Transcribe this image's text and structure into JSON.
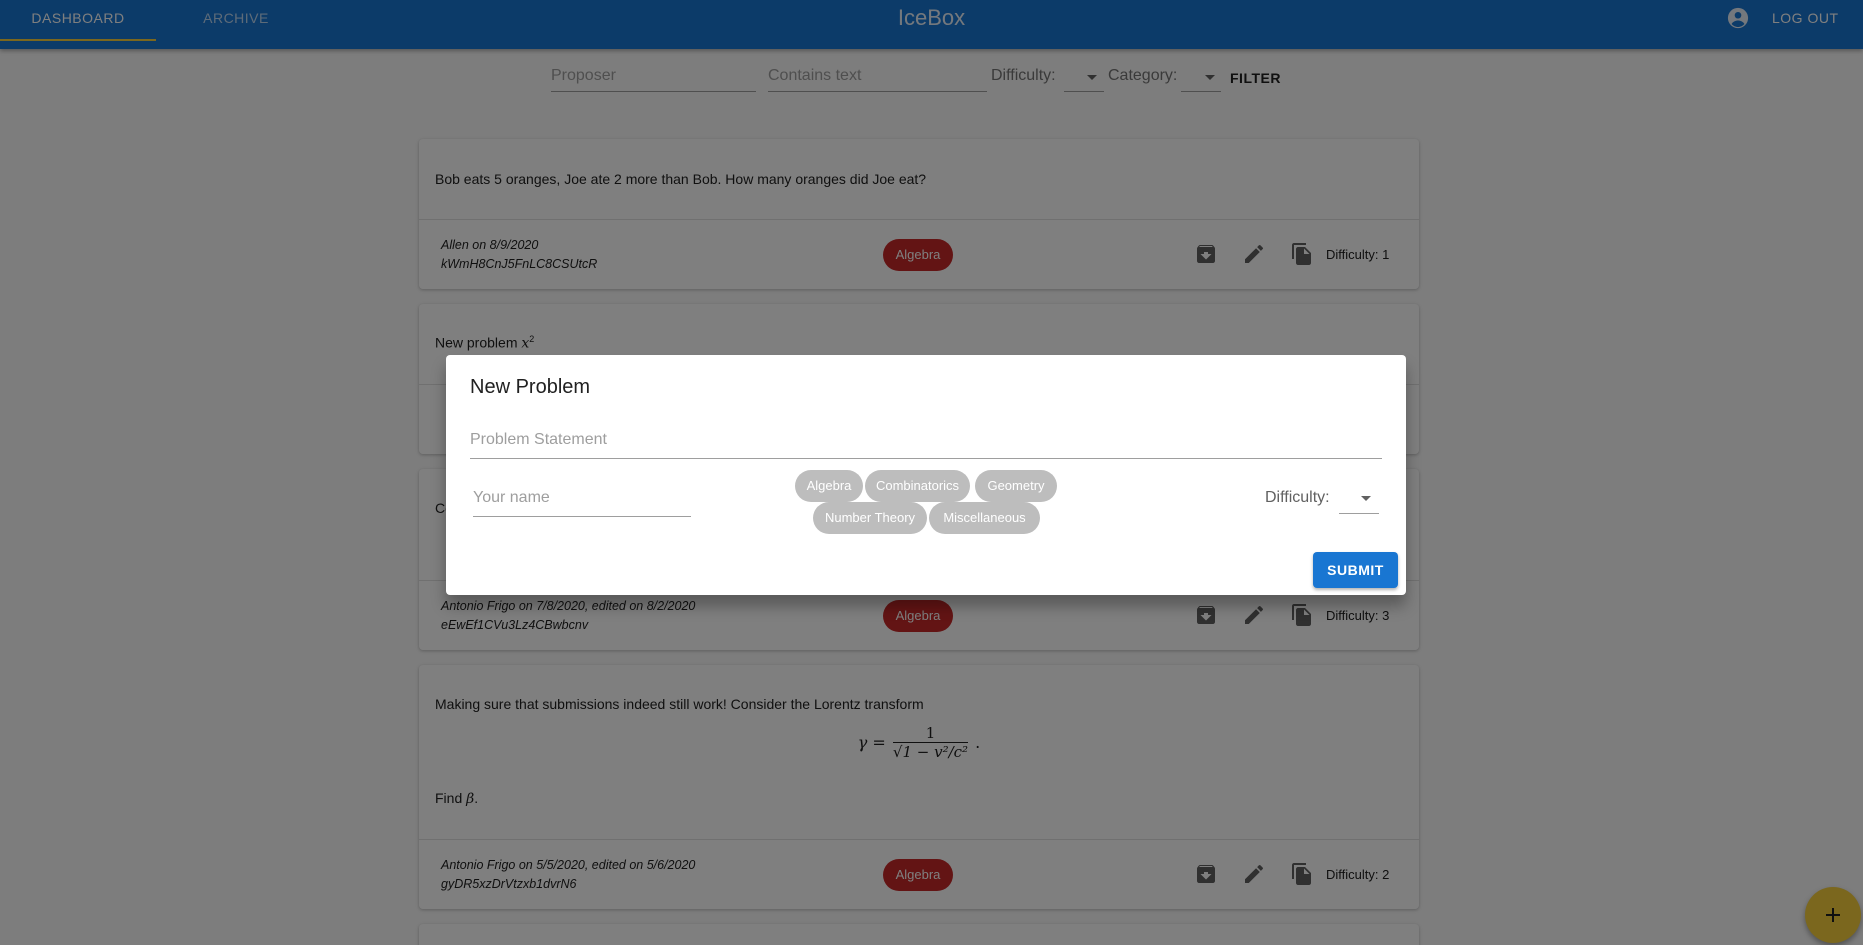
{
  "appbar": {
    "tabs": [
      {
        "label": "DASHBOARD",
        "active": true
      },
      {
        "label": "ARCHIVE",
        "active": false
      }
    ],
    "title": "IceBox",
    "logout_label": "LOG OUT",
    "account_icon": "account-circle-icon",
    "colors": {
      "primary": "#1976d2",
      "indicator": "#f6cf3c"
    }
  },
  "filters": {
    "proposer_placeholder": "Proposer",
    "text_placeholder": "Contains text",
    "difficulty_label": "Difficulty:",
    "category_label": "Category:",
    "filter_label": "FILTER"
  },
  "problems": [
    {
      "statement": "Bob eats 5 oranges, Joe ate 2 more than Bob. How many oranges did Joe eat?",
      "author_line": "Allen on 8/9/2020",
      "id": "kWmH8CnJ5FnLC8CSUtcR",
      "category": "Algebra",
      "difficulty": "Difficulty: 1"
    },
    {
      "statement": "New problem",
      "math": "x",
      "math_sup": "2"
    },
    {
      "statement_visible": "Co",
      "author_line": "Antonio Frigo on 7/8/2020, edited on 8/2/2020",
      "id": "eEwEf1CVu3Lz4CBwbcnv",
      "category": "Algebra",
      "difficulty": "Difficulty: 3"
    },
    {
      "statement": "Making sure that submissions indeed still work! Consider the Lorentz transform",
      "math_lhs": "γ =",
      "math_num": "1",
      "math_den": "1 − v²/c²",
      "math_tail": ".",
      "find_text": "Find",
      "find_var": "β",
      "find_tail": ".",
      "author_line": "Antonio Frigo on 5/5/2020, edited on 5/6/2020",
      "id": "gyDR5xzDrVtzxb1dvrN6",
      "category": "Algebra",
      "difficulty": "Difficulty: 2"
    }
  ],
  "dialog": {
    "title": "New Problem",
    "statement_placeholder": "Problem Statement",
    "name_placeholder": "Your name",
    "categories": [
      "Algebra",
      "Combinatorics",
      "Geometry",
      "Number Theory",
      "Miscellaneous"
    ],
    "difficulty_label": "Difficulty:",
    "submit_label": "SUBMIT"
  },
  "fab_icon": "add-icon",
  "colors": {
    "chip_red": "#c62828",
    "chip_grey": "#bdbdbd",
    "fab": "#f6cf3c"
  }
}
